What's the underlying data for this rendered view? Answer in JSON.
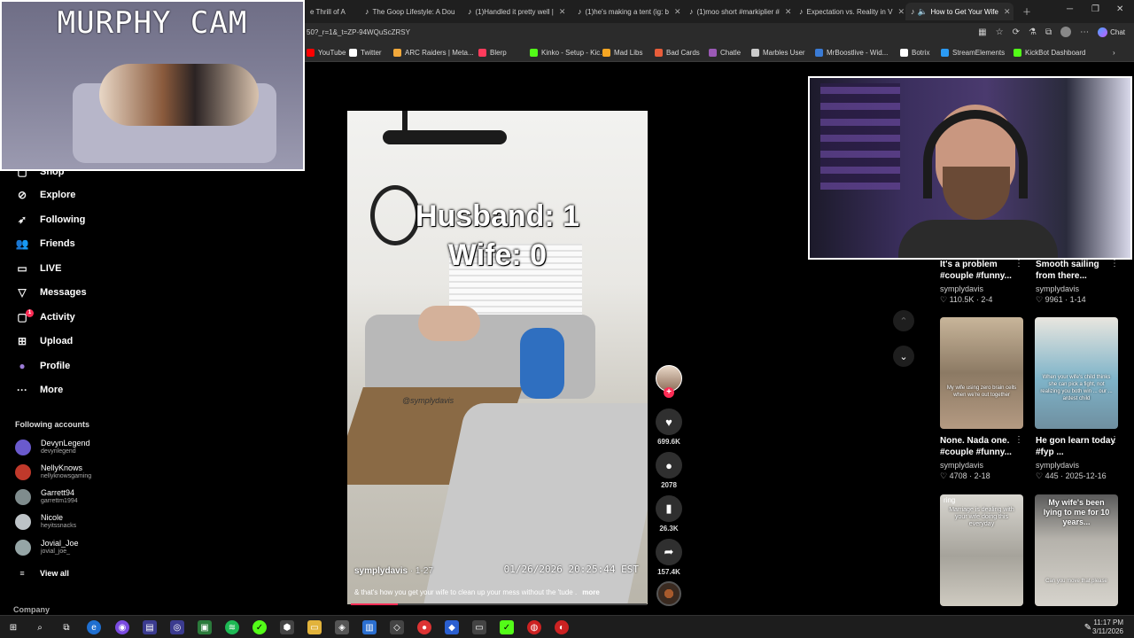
{
  "browser": {
    "tabs": [
      {
        "label": "e Thrill of A",
        "left": 0
      },
      {
        "label": "The Goop Lifestyle: A Dou",
        "left": 0
      },
      {
        "label": "(1)Handled it pretty well |",
        "left": 0
      },
      {
        "label": "(1)he's making a tent (ig: b",
        "left": 0
      },
      {
        "label": "(1)moo short #markiplier #",
        "left": 0
      },
      {
        "label": "Expectation vs. Reality in V",
        "left": 0
      },
      {
        "label": "How to Get Your Wife",
        "left": 0
      }
    ],
    "url": "50?_r=1&_t=ZP-94WQuScZRSY",
    "chat_label": "Chat",
    "bookmarks": [
      {
        "label": "YouTube",
        "color": "#ff0000"
      },
      {
        "label": "Twitter",
        "color": "#ffffff"
      },
      {
        "label": "ARC Raiders | Meta...",
        "color": "#f2a93b"
      },
      {
        "label": "Blerp",
        "color": "#ff3b5c"
      },
      {
        "label": "Kinko - Setup - Kic...",
        "color": "#53fc18"
      },
      {
        "label": "Mad Libs",
        "color": "#f5a623"
      },
      {
        "label": "Bad Cards",
        "color": "#e85d3a"
      },
      {
        "label": "Chatle",
        "color": "#9b59b6"
      },
      {
        "label": "Marbles User",
        "color": "#cccccc"
      },
      {
        "label": "MrBoostlive - Wid...",
        "color": "#3a7bd5"
      },
      {
        "label": "Botrix",
        "color": "#ffffff"
      },
      {
        "label": "StreamElements",
        "color": "#2b9bf4"
      },
      {
        "label": "KickBot Dashboard",
        "color": "#53fc18"
      }
    ]
  },
  "murphy_cam": {
    "title": "MURPHY CAM"
  },
  "sidebar": {
    "partial_item": "Shop",
    "items": [
      {
        "label": "Explore",
        "icon": "compass-icon",
        "glyph": "⊘"
      },
      {
        "label": "Following",
        "icon": "following-icon",
        "glyph": "➶"
      },
      {
        "label": "Friends",
        "icon": "friends-icon",
        "glyph": "👥"
      },
      {
        "label": "LIVE",
        "icon": "live-icon",
        "glyph": "▭"
      },
      {
        "label": "Messages",
        "icon": "messages-icon",
        "glyph": "▽"
      },
      {
        "label": "Activity",
        "icon": "activity-icon",
        "glyph": "▢"
      },
      {
        "label": "Upload",
        "icon": "upload-icon",
        "glyph": "⊞"
      },
      {
        "label": "Profile",
        "icon": "profile-avatar",
        "glyph": "●"
      },
      {
        "label": "More",
        "icon": "more-icon",
        "glyph": "···"
      }
    ],
    "activity_badge": "1",
    "following_title": "Following accounts",
    "accounts": [
      {
        "name": "DevynLegend",
        "handle": "devynlegend",
        "color": "#6a5acd"
      },
      {
        "name": "NellyKnows",
        "handle": "nellyknowsgaming",
        "color": "#c0392b"
      },
      {
        "name": "Garrett94",
        "handle": "garrettm1994",
        "color": "#7f8c8d"
      },
      {
        "name": "Nicole",
        "handle": "heyitssnacks",
        "color": "#bdc3c7"
      },
      {
        "name": "Jovial_Joe",
        "handle": "jovial_joe_",
        "color": "#95a5a6"
      }
    ],
    "view_all": "View all",
    "company": "Company"
  },
  "video": {
    "overlay_line1": "Husband: 1",
    "overlay_line2": "Wife: 0",
    "watermark": "@symplydavis",
    "author": "symplydavis",
    "date": "· 1-27",
    "timestamp": "01/26/2026 20:25:44 EST",
    "caption": "& that's how you get your wife to clean up your mess without the 'tude .",
    "more": "more",
    "progress": 0.16
  },
  "actions": {
    "likes": "699.6K",
    "comments": "2078",
    "saves": "26.3K",
    "shares": "157.4K"
  },
  "related": [
    {
      "title": "It's a problem #couple #funny...",
      "author": "symplydavis",
      "stats": "♡ 110.5K · 2-4"
    },
    {
      "title": "Smooth sailing from there...",
      "author": "symplydavis",
      "stats": "♡ 9961 · 1-14"
    },
    {
      "title": "None. Nada one. #couple #funny...",
      "author": "symplydavis",
      "stats": "♡ 4708 · 2-18",
      "thumb_text": "My wife using zero brain cells when we're out together"
    },
    {
      "title": "He gon learn today #fyp ...",
      "author": "symplydavis",
      "stats": "♡ 445 · 2025-12-16",
      "thumb_text": "When your wife's child thinks she can pick a fight, not realizing you both win ... our ... ardest child"
    },
    {
      "thumb_text": "Marriage is dealing with your wife doing this everyday",
      "ring": "ring"
    },
    {
      "thumb_text": "My wife's been lying to me for 10 years...",
      "sub_text": "Can you move that please"
    }
  ],
  "taskbar": {
    "time": "11:17 PM",
    "date": "3/11/2026"
  }
}
